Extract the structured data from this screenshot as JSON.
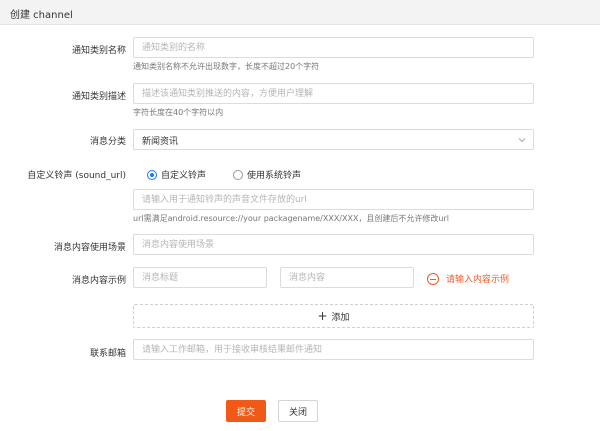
{
  "header": {
    "title": "创建 channel"
  },
  "form": {
    "category_name": {
      "label": "通知类别名称",
      "placeholder": "通知类别的名称",
      "value": "",
      "hint": "通知类别名称不允许出现数字，长度不超过20个字符"
    },
    "category_desc": {
      "label": "通知类别描述",
      "placeholder": "描述该通知类别推送的内容，方便用户理解",
      "value": "",
      "hint": "字符长度在40个字符以内"
    },
    "message_category": {
      "label": "消息分类",
      "selected": "新闻资讯"
    },
    "sound": {
      "label": "自定义铃声 (sound_url)",
      "options": [
        {
          "label": "自定义铃声",
          "checked": true
        },
        {
          "label": "使用系统铃声",
          "checked": false
        }
      ],
      "placeholder": "请输入用于通知铃声的声音文件存放的url",
      "value": "",
      "hint": "url需满足android.resource://your packagename/XXX/XXX，且创建后不允许修改url"
    },
    "usage_scene": {
      "label": "消息内容使用场景",
      "placeholder": "消息内容使用场景",
      "value": ""
    },
    "content_example": {
      "label": "消息内容示例",
      "title_placeholder": "消息标题",
      "content_placeholder": "消息内容",
      "remove_text": "请输入内容示例",
      "add_label": "添加",
      "add_symbol": "+"
    },
    "email": {
      "label": "联系邮箱",
      "placeholder": "请输入工作邮箱，用于接收审核结果邮件通知",
      "value": ""
    }
  },
  "actions": {
    "submit": "提交",
    "close": "关闭"
  },
  "colors": {
    "accent": "#f05a16",
    "radio": "#1677ff",
    "remove": "#f05a28"
  },
  "icons": {
    "chevron": "chevron-down-icon",
    "remove": "minus-circle-icon",
    "add": "plus-icon"
  }
}
